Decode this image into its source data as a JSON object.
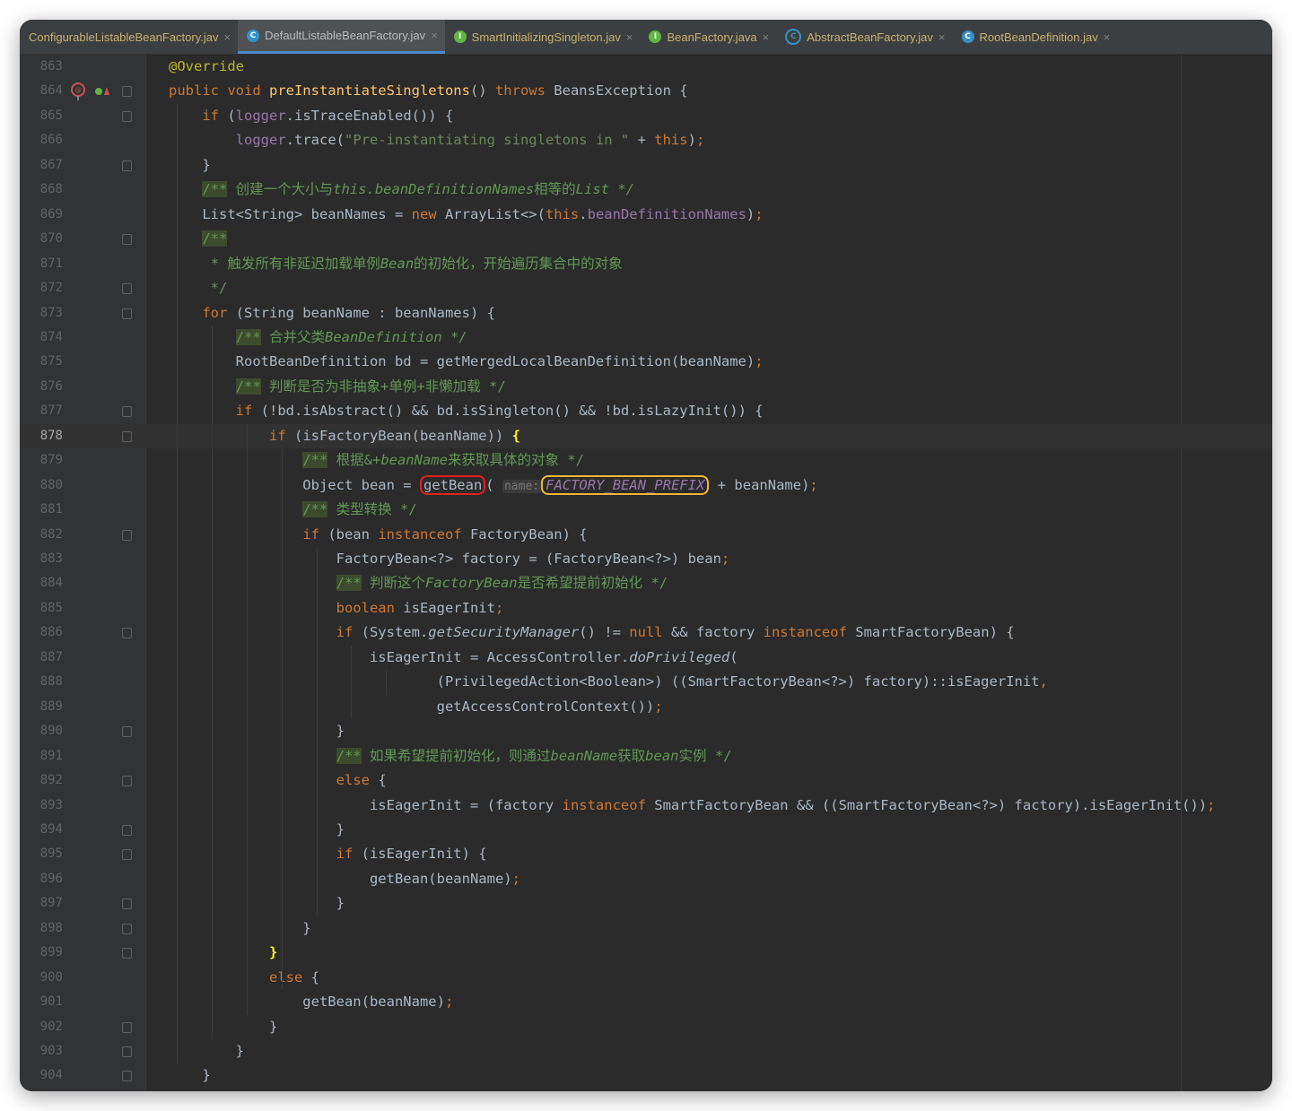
{
  "tabs": [
    {
      "label": "ConfigurableListableBeanFactory.jav",
      "icon": "none",
      "active": false
    },
    {
      "label": "DefaultListableBeanFactory.jav",
      "icon": "class",
      "active": true
    },
    {
      "label": "SmartInitializingSingleton.jav",
      "icon": "interface",
      "active": false
    },
    {
      "label": "BeanFactory.java",
      "icon": "interface",
      "active": false
    },
    {
      "label": "AbstractBeanFactory.jav",
      "icon": "abstract-class",
      "active": false
    },
    {
      "label": "RootBeanDefinition.jav",
      "icon": "class",
      "active": false
    }
  ],
  "tab_icon_letters": {
    "class": "C",
    "interface": "I",
    "abstract-class": "C"
  },
  "current_line": "878",
  "lines": [
    {
      "n": "863",
      "html": "<span class=\"a\">@Override</span>"
    },
    {
      "n": "864",
      "html": "<span class=\"k\">public void </span><span class=\"m\">preInstantiateSingletons</span>() <span class=\"k\">throws </span>BeansException {"
    },
    {
      "n": "865",
      "html": "    <span class=\"k\">if </span>(<span class=\"f\">logger</span>.isTraceEnabled()) {"
    },
    {
      "n": "866",
      "html": "        <span class=\"f\">logger</span>.trace(<span class=\"s\">\"Pre-instantiating singletons in \"</span> + <span class=\"k\">this</span>)<span class=\"k\">;</span>"
    },
    {
      "n": "867",
      "html": "    }"
    },
    {
      "n": "868",
      "html": "    <span class=\"cbox\">/**</span><span class=\"ci\"> 创建一个大小与</span><span class=\"c\">this.beanDefinitionNames</span><span class=\"ci\">相等的</span><span class=\"c\">List */</span>"
    },
    {
      "n": "869",
      "html": "    List&lt;String&gt; beanNames = <span class=\"k\">new </span>ArrayList&lt;&gt;(<span class=\"k\">this</span>.<span class=\"f\">beanDefinitionNames</span>)<span class=\"k\">;</span>"
    },
    {
      "n": "870",
      "html": "    <span class=\"cbox\">/**</span>"
    },
    {
      "n": "871",
      "html": "     <span class=\"ci\">* 触发所有非延迟加载单例</span><span class=\"c\">Bean</span><span class=\"ci\">的初始化，开始遍历集合中的对象</span>"
    },
    {
      "n": "872",
      "html": "     <span class=\"ci\">*/</span>"
    },
    {
      "n": "873",
      "html": "    <span class=\"k\">for </span>(String beanName : beanNames) {"
    },
    {
      "n": "874",
      "html": "        <span class=\"cbox\">/**</span><span class=\"ci\"> 合并父类</span><span class=\"c\">BeanDefinition */</span>"
    },
    {
      "n": "875",
      "html": "        RootBeanDefinition bd = getMergedLocalBeanDefinition(beanName)<span class=\"k\">;</span>"
    },
    {
      "n": "876",
      "html": "        <span class=\"cbox\">/**</span><span class=\"ci\"> 判断是否为非抽象+单例+非懒加载 */</span>"
    },
    {
      "n": "877",
      "html": "        <span class=\"k\">if </span>(!bd.isAbstract() &amp;&amp; bd.isSingleton() &amp;&amp; !bd.isLazyInit()) {"
    },
    {
      "n": "878",
      "html": "            <span class=\"k\">if </span>(isFactoryBean(beanName)) <span class=\"brm\">{</span>"
    },
    {
      "n": "879",
      "html": "                <span class=\"cbox\">/**</span><span class=\"ci\"> 根据&amp;+</span><span class=\"c\">beanName</span><span class=\"ci\">来获取具体的对象 */</span>"
    },
    {
      "n": "880",
      "html": "                Object bean = <span class=\"red\">getBean</span>( <span class=\"hint\">name:</span><span class=\"yel\">FACTORY_BEAN_PREFIX</span> + beanName)<span class=\"k\">;</span>"
    },
    {
      "n": "881",
      "html": "                <span class=\"cbox\">/**</span><span class=\"ci\"> 类型转换 */</span>"
    },
    {
      "n": "882",
      "html": "                <span class=\"k\">if </span>(bean <span class=\"k\">instanceof </span>FactoryBean) {"
    },
    {
      "n": "883",
      "html": "                    FactoryBean&lt;?&gt; factory = (FactoryBean&lt;?&gt;) bean<span class=\"k\">;</span>"
    },
    {
      "n": "884",
      "html": "                    <span class=\"cbox\">/**</span><span class=\"ci\"> 判断这个</span><span class=\"c\">FactoryBean</span><span class=\"ci\">是否希望提前初始化 */</span>"
    },
    {
      "n": "885",
      "html": "                    <span class=\"k\">boolean </span>isEagerInit<span class=\"k\">;</span>"
    },
    {
      "n": "886",
      "html": "                    <span class=\"k\">if </span>(System.<span class=\"st\">getSecurityManager</span>() != <span class=\"k\">null </span>&amp;&amp; factory <span class=\"k\">instanceof </span>SmartFactoryBean) {"
    },
    {
      "n": "887",
      "html": "                        isEagerInit = AccessController.<span class=\"st\">doPrivileged</span>("
    },
    {
      "n": "888",
      "html": "                                (PrivilegedAction&lt;Boolean&gt;) ((SmartFactoryBean&lt;?&gt;) factory)::isEagerInit<span class=\"k\">,</span>"
    },
    {
      "n": "889",
      "html": "                                getAccessControlContext())<span class=\"k\">;</span>"
    },
    {
      "n": "890",
      "html": "                    }"
    },
    {
      "n": "891",
      "html": "                    <span class=\"cbox\">/**</span><span class=\"ci\"> 如果希望提前初始化，则通过</span><span class=\"c\">beanName</span><span class=\"ci\">获取</span><span class=\"c\">bean</span><span class=\"ci\">实例 */</span>"
    },
    {
      "n": "892",
      "html": "                    <span class=\"k\">else </span>{"
    },
    {
      "n": "893",
      "html": "                        isEagerInit = (factory <span class=\"k\">instanceof </span>SmartFactoryBean &amp;&amp; ((SmartFactoryBean&lt;?&gt;) factory).isEagerInit())<span class=\"k\">;</span>"
    },
    {
      "n": "894",
      "html": "                    }"
    },
    {
      "n": "895",
      "html": "                    <span class=\"k\">if </span>(isEagerInit) {"
    },
    {
      "n": "896",
      "html": "                        getBean(beanName)<span class=\"k\">;</span>"
    },
    {
      "n": "897",
      "html": "                    }"
    },
    {
      "n": "898",
      "html": "                }"
    },
    {
      "n": "899",
      "html": "            <span class=\"brm\">}</span>"
    },
    {
      "n": "900",
      "html": "            <span class=\"k\">else </span>{"
    },
    {
      "n": "901",
      "html": "                getBean(beanName)<span class=\"k\">;</span>"
    },
    {
      "n": "902",
      "html": "            }"
    },
    {
      "n": "903",
      "html": "        }"
    },
    {
      "n": "904",
      "html": "    }"
    }
  ],
  "folds": [
    "864",
    "865",
    "867",
    "870",
    "872",
    "873",
    "877",
    "878",
    "882",
    "886",
    "890",
    "892",
    "894",
    "895",
    "897",
    "898",
    "899",
    "902",
    "903",
    "904"
  ],
  "gutter_icons": {
    "line": "864",
    "items": [
      "breakpoint-icon",
      "override-up-icon"
    ]
  },
  "colors": {
    "background": "#2b2b2b",
    "keyword": "#cc7832",
    "method": "#ffc66d",
    "string": "#6a8759",
    "field": "#9876aa",
    "comment": "#629755",
    "highlight_red": "#e0201f",
    "highlight_yellow": "#f2b632"
  }
}
